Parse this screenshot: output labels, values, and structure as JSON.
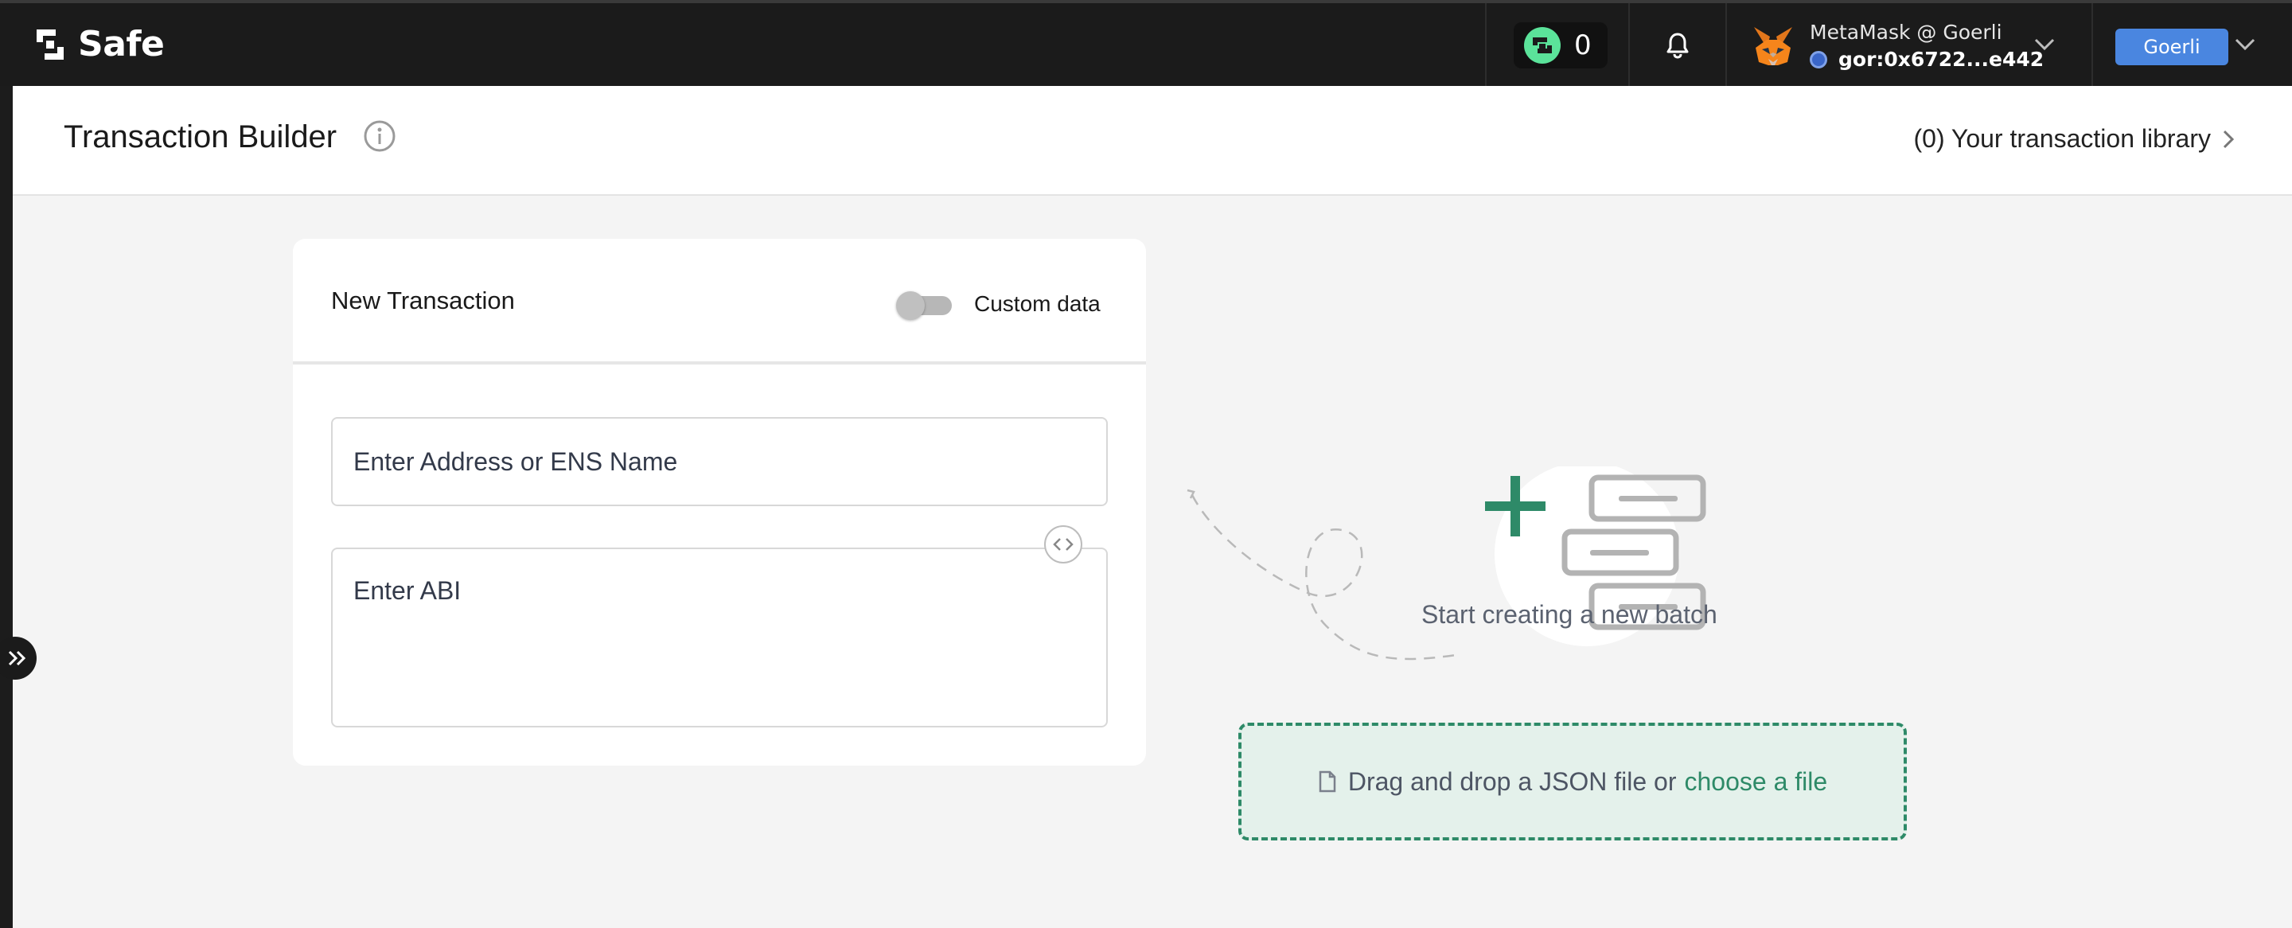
{
  "app": {
    "brand": "Safe"
  },
  "topbar": {
    "pending_count": "0",
    "wallet_name": "MetaMask @ Goerli",
    "wallet_address": "gor:0x6722...e442",
    "network_label": "Goerli"
  },
  "header": {
    "title": "Transaction Builder",
    "library_link": "(0) Your transaction library"
  },
  "new_transaction": {
    "title": "New Transaction",
    "custom_data_label": "Custom data",
    "custom_data_enabled": false,
    "address_placeholder": "Enter Address or ENS Name",
    "abi_placeholder": "Enter ABI"
  },
  "batch": {
    "empty_text": "Start creating a new batch",
    "drop_text": "Drag and drop a JSON file or",
    "choose_file_link": "choose a file"
  },
  "colors": {
    "topbar_bg": "#1b1b1b",
    "accent_green": "#2e8a68",
    "network_blue": "#4a86e0",
    "page_bg": "#f4f4f4"
  },
  "icons": [
    "safe-logo-icon",
    "pending-tx-icon",
    "bell-icon",
    "metamask-fox-icon",
    "chevron-down-icon",
    "info-icon",
    "chevron-right-icon",
    "code-icon",
    "file-icon",
    "double-chevron-right-icon",
    "batch-illustration"
  ]
}
